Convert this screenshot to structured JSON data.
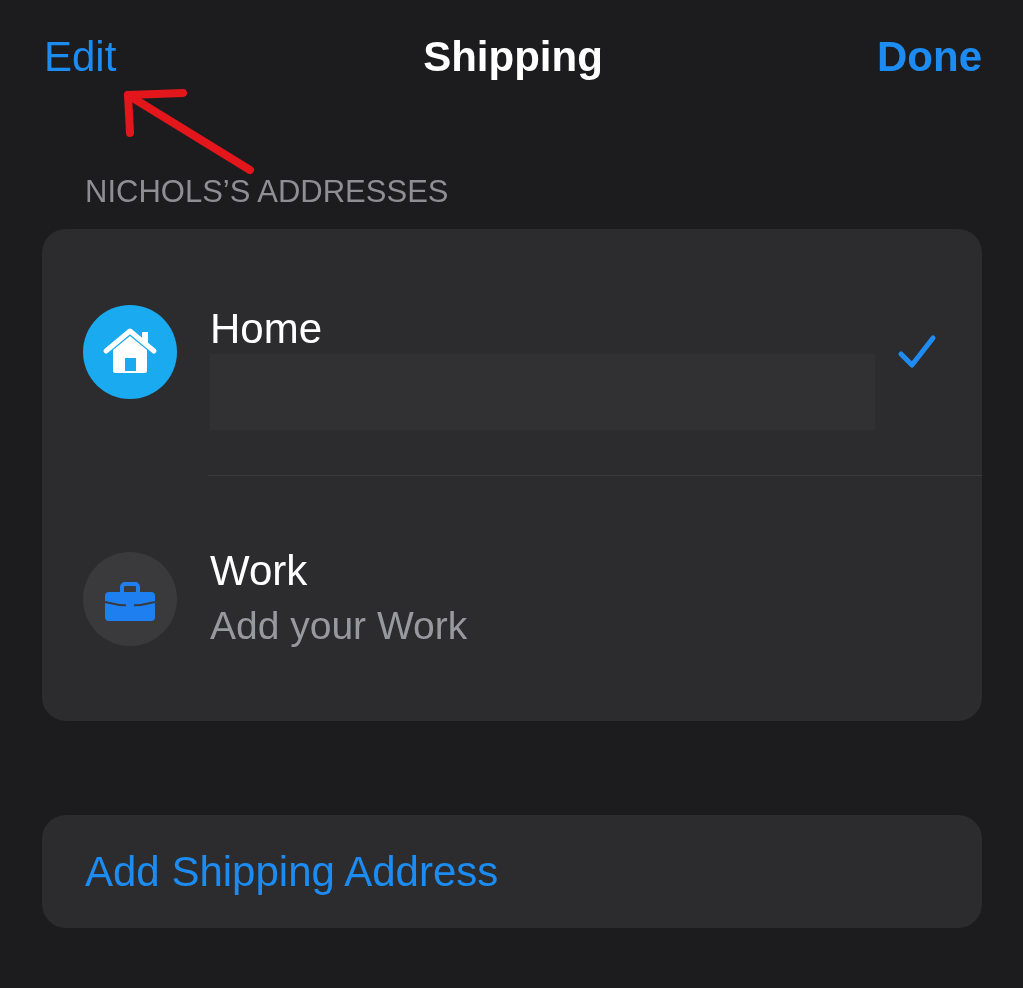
{
  "nav": {
    "left_button": "Edit",
    "title": "Shipping",
    "right_button": "Done"
  },
  "section": {
    "title": "NICHOLS’S ADDRESSES"
  },
  "addresses": [
    {
      "kind": "home",
      "label": "Home",
      "redacted": true,
      "selected": true
    },
    {
      "kind": "work",
      "label": "Work",
      "subtitle": "Add your Work",
      "redacted": false,
      "selected": false
    }
  ],
  "add_button": {
    "label": "Add Shipping Address"
  },
  "annotations": [
    {
      "kind": "arrow"
    }
  ]
}
